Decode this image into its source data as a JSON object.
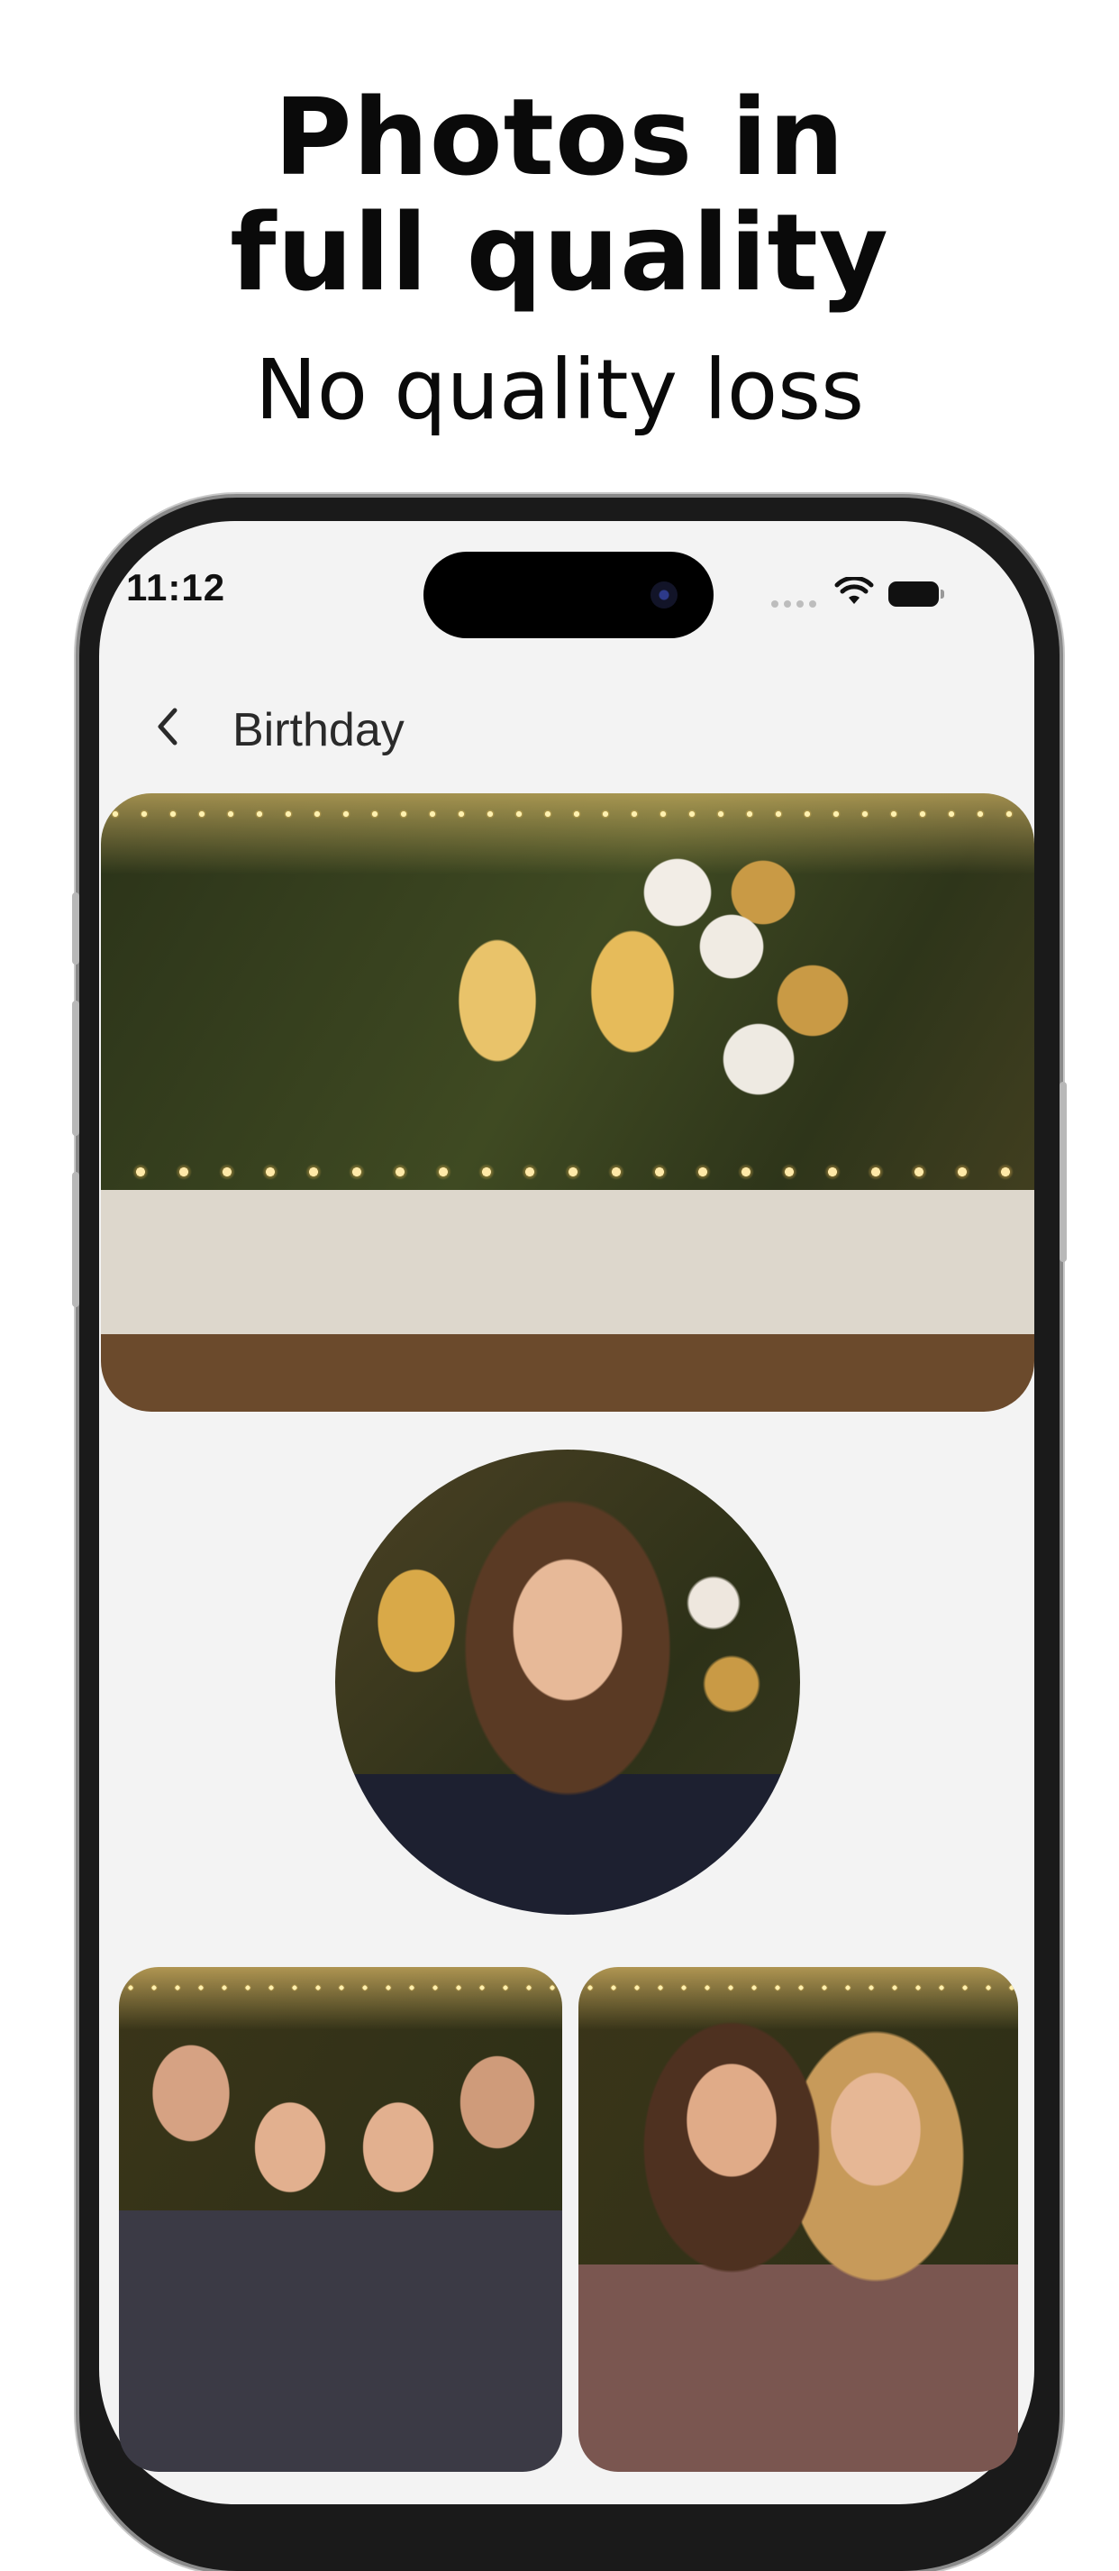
{
  "promo": {
    "headline_line1": "Photos in",
    "headline_line2": "full quality",
    "subheadline": "No quality loss"
  },
  "status_bar": {
    "time": "11:12",
    "icons": [
      "signal-dots-icon",
      "wifi-icon",
      "battery-icon"
    ]
  },
  "nav": {
    "back_icon": "chevron-left-icon",
    "title": "Birthday"
  },
  "album": {
    "photos": [
      {
        "name": "party-table-photo",
        "shape": "rounded-rectangle"
      },
      {
        "name": "portrait-photo",
        "shape": "circle"
      },
      {
        "name": "friends-group-photo",
        "shape": "rounded-rectangle"
      },
      {
        "name": "two-friends-photo",
        "shape": "rounded-rectangle"
      }
    ]
  },
  "colors": {
    "headline_text": "#0a0a0a",
    "screen_background": "#f3f3f3",
    "phone_frame": "#1a1a1a",
    "accent_gold": "#e6bb5a"
  }
}
